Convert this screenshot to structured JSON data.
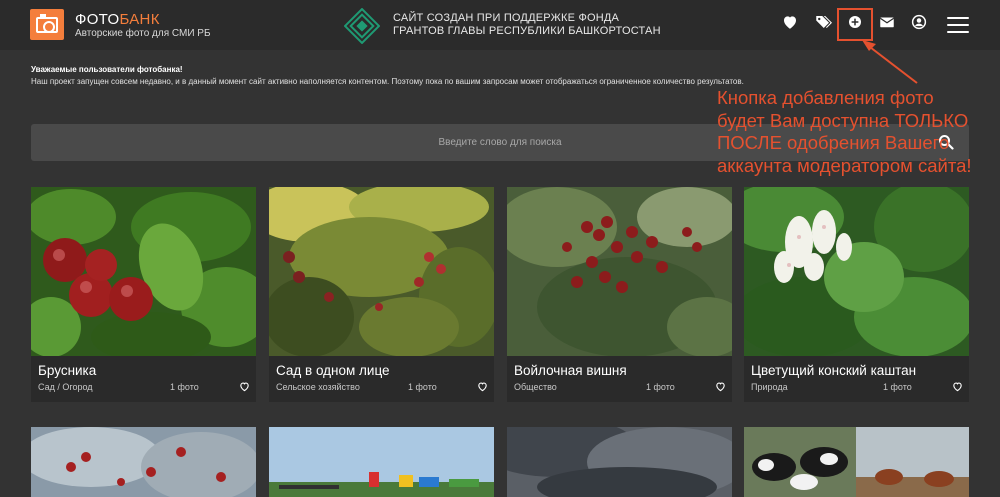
{
  "header": {
    "brand_part1": "ФОТО",
    "brand_part2": "БАНК",
    "brand_subtitle": "Авторские фото для СМИ РБ",
    "fund_line1": "САЙТ СОЗДАН ПРИ ПОДДЕРЖКЕ ФОНДА",
    "fund_line2": "ГРАНТОВ ГЛАВЫ РЕСПУБЛИКИ БАШКОРТОСТАН",
    "icons": [
      "heart-icon",
      "tags-icon",
      "plus-circle-icon",
      "envelope-icon",
      "user-circle-icon",
      "hamburger-menu-icon"
    ],
    "accent_color": "#f47e3c"
  },
  "notice": {
    "title": "Уважаемые пользователи фотобанка!",
    "text": "Наш проект запущен совсем недавно, и в данный момент сайт активно наполняется контентом. Поэтому пока по вашим запросам может отображаться ограниченное количество результатов."
  },
  "search": {
    "placeholder": "Введите слово для поиска"
  },
  "annotation": {
    "line1": "Кнопка добавления фото",
    "line2": "будет Вам доступна ТОЛЬКО",
    "line3": "ПОСЛЕ одобрения Вашего",
    "line4": "аккаунта модератором сайта!",
    "color": "#e5512f"
  },
  "cards": [
    {
      "title": "Брусника",
      "category": "Сад / Огород",
      "count": "1 фото"
    },
    {
      "title": "Сад в одном лице",
      "category": "Сельское хозяйство",
      "count": "1 фото"
    },
    {
      "title": "Войлочная вишня",
      "category": "Общество",
      "count": "1 фото"
    },
    {
      "title": "Цветущий конский каштан",
      "category": "Природа",
      "count": "1 фото"
    }
  ]
}
